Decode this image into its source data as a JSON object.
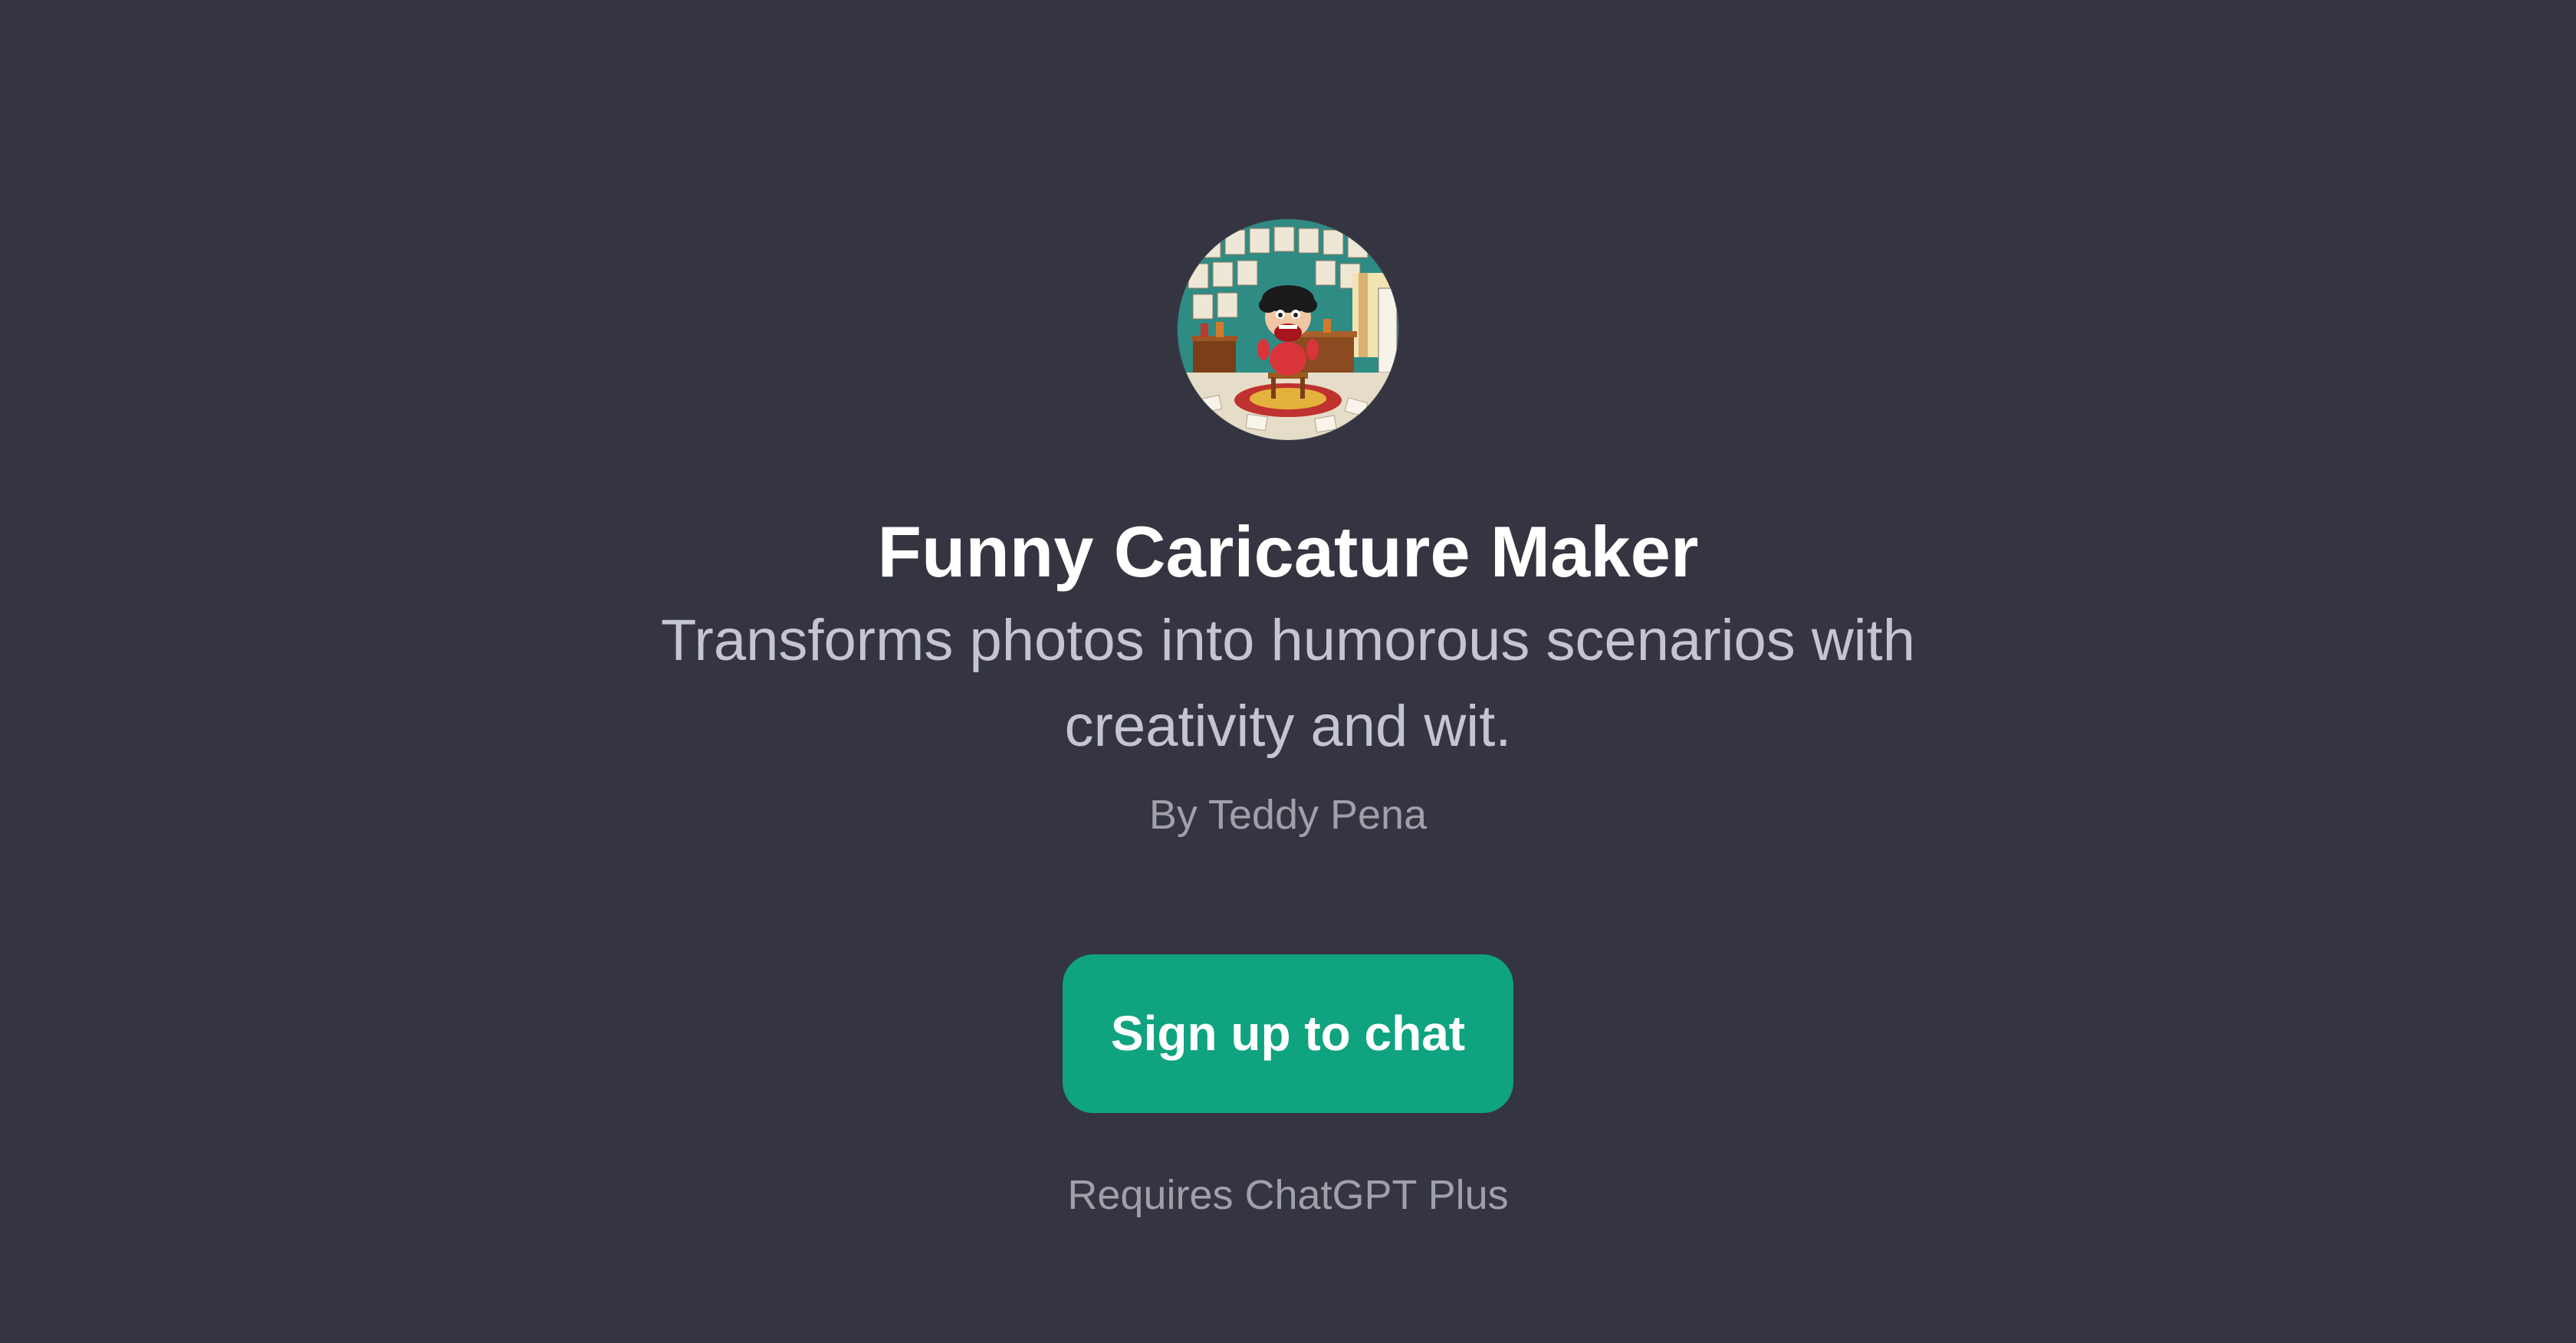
{
  "gpt": {
    "name": "Funny Caricature Maker",
    "description": "Transforms photos into humorous scenarios with creativity and wit.",
    "author": "By Teddy Pena",
    "avatar_icon": "caricature-artist-avatar"
  },
  "actions": {
    "signup_label": "Sign up to chat"
  },
  "footer": {
    "requirement": "Requires ChatGPT Plus"
  },
  "colors": {
    "background": "#343541",
    "accent": "#10a37f",
    "title": "#ffffff",
    "description": "#c5c5d2",
    "muted": "#a0a0ab"
  }
}
